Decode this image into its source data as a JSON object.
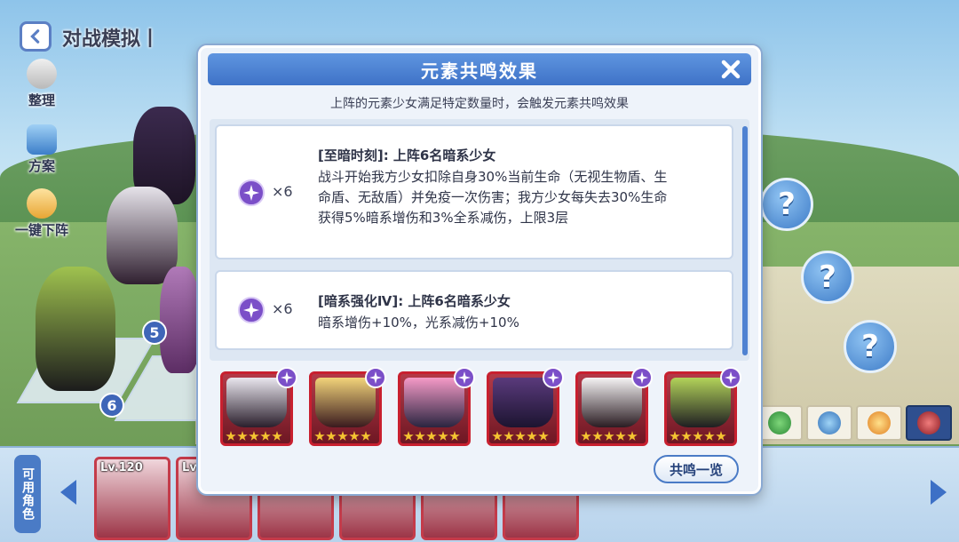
{
  "header": {
    "title": "对战模拟丨"
  },
  "side_menu": [
    {
      "label": "整理"
    },
    {
      "label": "方案"
    },
    {
      "label": "一键下阵"
    }
  ],
  "field": {
    "slot_numbers": [
      "5",
      "6"
    ],
    "unknown_marker": "?"
  },
  "roster": {
    "label": "可用角色",
    "cards": [
      {
        "level": "Lv.120"
      },
      {
        "level": "Lv"
      },
      {
        "level": ""
      },
      {
        "level": ""
      },
      {
        "level": ""
      },
      {
        "level": ""
      }
    ]
  },
  "dialog": {
    "title": "元素共鸣效果",
    "subtitle": "上阵的元素少女满足特定数量时，会触发元素共鸣效果",
    "entries": [
      {
        "count": "×6",
        "title": "[至暗时刻]: 上阵6名暗系少女",
        "description": "战斗开始我方少女扣除自身30%当前生命（无视生物盾、生命盾、无敌盾）并免疫一次伤害；我方少女每失去30%生命获得5%暗系增伤和3%全系减伤，上限3层"
      },
      {
        "count": "×6",
        "title": "[暗系强化Ⅳ]: 上阵6名暗系少女",
        "description": "暗系增伤+10%，光系减伤+10%"
      }
    ],
    "team_cards": [
      {
        "stars": 5,
        "element": "dark"
      },
      {
        "stars": 5,
        "element": "dark"
      },
      {
        "stars": 5,
        "element": "dark"
      },
      {
        "stars": 5,
        "element": "dark"
      },
      {
        "stars": 5,
        "element": "dark"
      },
      {
        "stars": 5,
        "element": "dark"
      }
    ],
    "overview_button": "共鸣一览",
    "close_icon": "close-icon"
  },
  "colors": {
    "accent_blue": "#3e72c7",
    "card_red": "#c8202f",
    "dark_gem": "#7b4fc8",
    "star": "#f5c431"
  }
}
